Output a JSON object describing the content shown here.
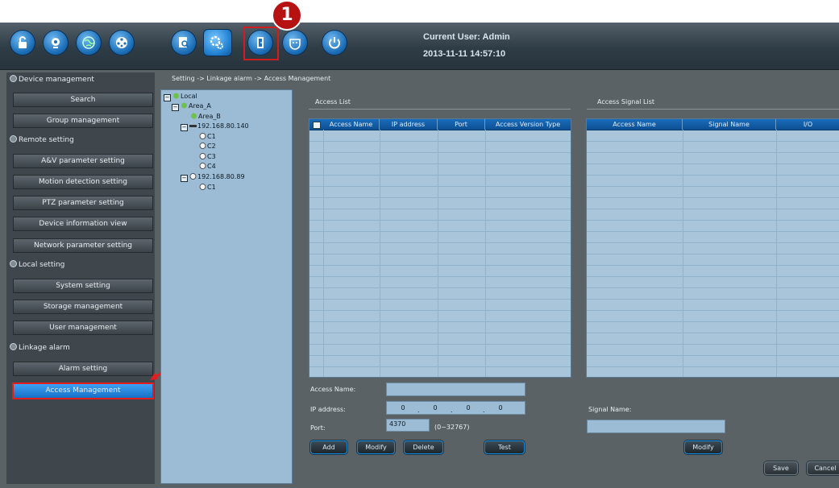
{
  "badge": "1",
  "header": {
    "current_user": "Current User: Admin",
    "datetime": "2013-11-11 14:57:10"
  },
  "toolbar": [
    {
      "icon": "lock-icon"
    },
    {
      "icon": "webcam-icon"
    },
    {
      "icon": "globe-icon"
    },
    {
      "icon": "film-reel-icon"
    },
    {
      "icon": "search-record-icon"
    },
    {
      "icon": "settings-icon",
      "active": true
    },
    {
      "icon": "door-access-icon",
      "highlighted": true
    },
    {
      "icon": "alarm-face-icon"
    },
    {
      "icon": "power-icon"
    }
  ],
  "breadcrumb": "Setting -> Linkage alarm -> Access Management",
  "sidebar": {
    "sections": [
      {
        "title": "Device management",
        "items": [
          "Search",
          "Group management"
        ]
      },
      {
        "title": "Remote setting",
        "items": [
          "A&V parameter setting",
          "Motion detection setting",
          "PTZ parameter setting",
          "Device information view",
          "Network parameter setting"
        ]
      },
      {
        "title": "Local setting",
        "items": [
          "System setting",
          "Storage management",
          "User management"
        ]
      },
      {
        "title": "Linkage alarm",
        "items": [
          "Alarm setting",
          "Access Management"
        ]
      }
    ],
    "selected": "Access Management"
  },
  "tree": {
    "root": "Local",
    "area_a": "Area_A",
    "area_b": "Area_B",
    "device1": "192.168.80.140",
    "device1_channels": [
      "C1",
      "C2",
      "C3",
      "C4"
    ],
    "device2": "192.168.80.89",
    "device2_channels": [
      "C1"
    ]
  },
  "access_list": {
    "title": "Access List",
    "columns": [
      "Access Name",
      "IP address",
      "Port",
      "Access Version Type"
    ]
  },
  "signal_list": {
    "title": "Access Signal List",
    "columns": [
      "Access Name",
      "Signal Name",
      "I/O"
    ]
  },
  "form": {
    "access_name_label": "Access Name:",
    "access_name_value": "",
    "ip_label": "IP address:",
    "ip_octets": [
      "0",
      "0",
      "0",
      "0"
    ],
    "port_label": "Port:",
    "port_value": "4370",
    "port_range": "(0~32767)",
    "signal_name_label": "Signal Name:",
    "signal_name_value": ""
  },
  "buttons": {
    "add": "Add",
    "modify": "Modify",
    "delete": "Delete",
    "test": "Test",
    "signal_modify": "Modify",
    "save": "Save",
    "cancel": "Cancel"
  },
  "colors": {
    "accent": "#1570c6",
    "highlight": "#d11d1d"
  }
}
